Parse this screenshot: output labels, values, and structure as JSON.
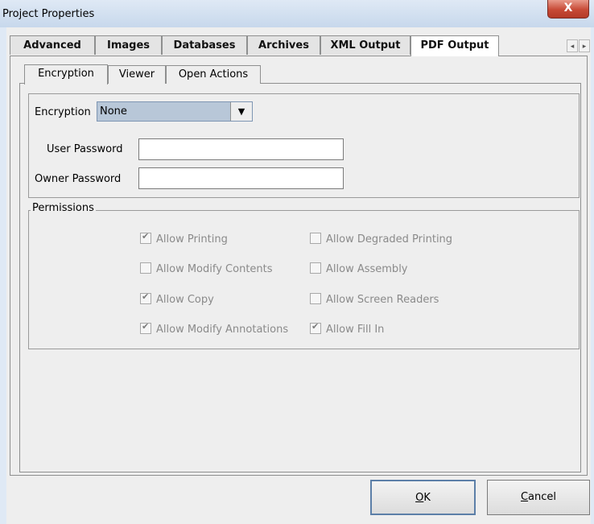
{
  "window": {
    "title": "Project Properties",
    "close_label": "X"
  },
  "tabs": [
    {
      "label": "Advanced",
      "active": false
    },
    {
      "label": "Images",
      "active": false
    },
    {
      "label": "Databases",
      "active": false
    },
    {
      "label": "Archives",
      "active": false
    },
    {
      "label": "XML Output",
      "active": false
    },
    {
      "label": "PDF Output",
      "active": true
    }
  ],
  "tab_scroll": {
    "left_icon": "◂",
    "right_icon": "▸"
  },
  "subtabs": [
    {
      "label": "Encryption",
      "active": true
    },
    {
      "label": "Viewer",
      "active": false
    },
    {
      "label": "Open Actions",
      "active": false
    }
  ],
  "encryption": {
    "label": "Encryption",
    "selected": "None",
    "arrow_icon": "▼",
    "user_password_label": "User Password",
    "user_password_value": "",
    "owner_password_label": "Owner Password",
    "owner_password_value": ""
  },
  "permissions": {
    "legend": "Permissions",
    "items": [
      {
        "label": "Allow Printing",
        "checked": true
      },
      {
        "label": "Allow Degraded Printing",
        "checked": false
      },
      {
        "label": "Allow Modify Contents",
        "checked": false
      },
      {
        "label": "Allow Assembly",
        "checked": false
      },
      {
        "label": "Allow Copy",
        "checked": true
      },
      {
        "label": "Allow Screen Readers",
        "checked": false
      },
      {
        "label": "Allow Modify Annotations",
        "checked": true
      },
      {
        "label": "Allow Fill In",
        "checked": true
      }
    ]
  },
  "buttons": {
    "ok_mnemonic": "O",
    "ok_rest": "K",
    "cancel_mnemonic": "C",
    "cancel_rest": "ancel"
  }
}
